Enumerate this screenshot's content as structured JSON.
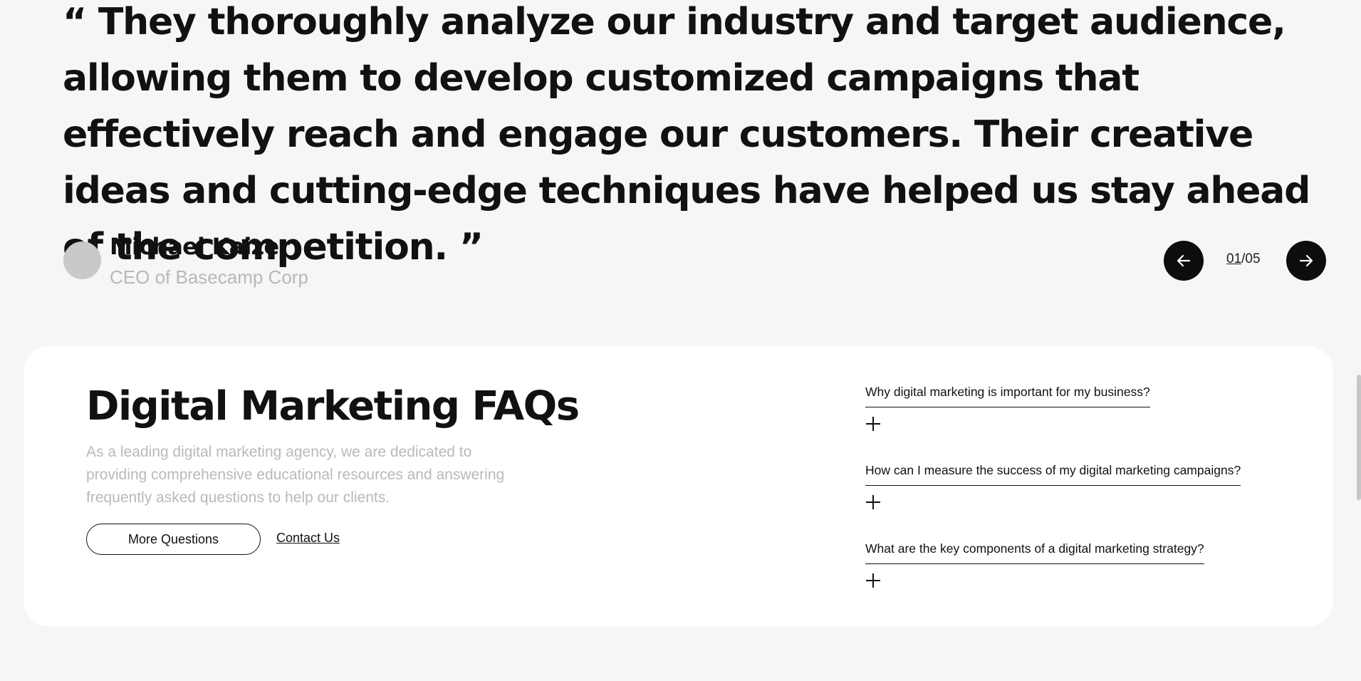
{
  "testimonial": {
    "quote": "“ They thoroughly analyze our industry and target audience, allowing them to develop customized campaigns that effectively reach and engage our customers. Their creative ideas and cutting-edge techniques have helped us stay ahead of the competition. ”",
    "author_name": "Michael Kaizer",
    "author_role": "CEO of Basecamp Corp",
    "pager_current": "01",
    "pager_total": "/05",
    "prev_icon": "arrow-left-icon",
    "next_icon": "arrow-right-icon"
  },
  "faq": {
    "title": "Digital Marketing FAQs",
    "description": "As a leading digital marketing agency, we are dedicated to providing comprehensive educational resources and answering frequently asked questions to help our clients.",
    "more_button": "More Questions",
    "contact_link": "Contact Us",
    "items": [
      {
        "question": "Why digital marketing is important for my business?"
      },
      {
        "question": "How can I measure the success of my digital marketing campaigns?"
      },
      {
        "question": "What are the key components of a digital marketing strategy?"
      }
    ]
  },
  "colors": {
    "background": "#f6f6f4",
    "card": "#ffffff",
    "text": "#111111",
    "muted": "#b9b9b9",
    "button_dark": "#0d0d0d"
  }
}
